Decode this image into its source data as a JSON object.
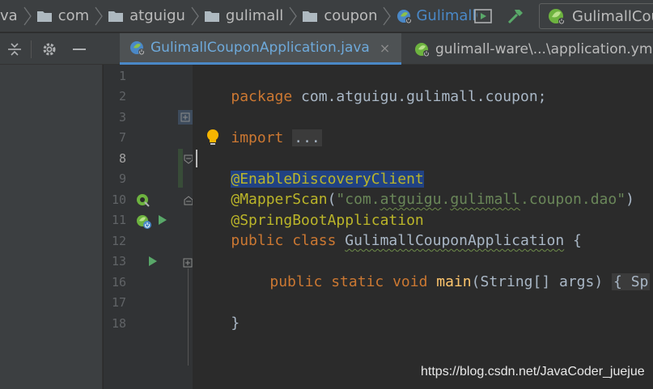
{
  "breadcrumbs": [
    "va",
    "com",
    "atguigu",
    "gulimall",
    "coupon",
    "GulimallC"
  ],
  "run_config_label": "GulimallCou",
  "tabs": [
    {
      "label": "GulimallCouponApplication.java",
      "close": "×"
    },
    {
      "label": "gulimall-ware\\...\\application.ym"
    }
  ],
  "line_numbers": [
    "1",
    "2",
    "3",
    "7",
    "8",
    "9",
    "10",
    "11",
    "12",
    "13",
    "16",
    "17",
    "18"
  ],
  "code": {
    "l1_kw": "package",
    "l1_rest": " com.atguigu.gulimall.coupon;",
    "l3_kw": "import",
    "l3_fold": "...",
    "l8": "@EnableDiscoveryClient",
    "l9_an": "@MapperScan",
    "l9_open": "(",
    "l9_str_a": "\"com.",
    "l9_str_b": "atguigu",
    "l9_str_c": ".",
    "l9_str_d": "gulimall",
    "l9_str_e": ".coupon.dao\"",
    "l9_close": ")",
    "l10": "@SpringBootApplication",
    "l11_kw": "public class",
    "l11_cls": "GulimallCouponApplication",
    "l11_rest": " {",
    "l13_kw": "public static void",
    "l13_fn": "main",
    "l13_args": "(String[] args) ",
    "l13_fold": "{ Sp",
    "l17": "}"
  },
  "watermark": "https://blog.csdn.net/JavaCoder_juejue",
  "colors": {
    "background": "#2b2b2b",
    "gutter": "#313335",
    "keyword": "#cc7832",
    "annotation": "#bbb529",
    "string": "#6a8759",
    "method": "#ffc66d",
    "selection": "#214283",
    "tab_underline": "#4a88c7"
  }
}
